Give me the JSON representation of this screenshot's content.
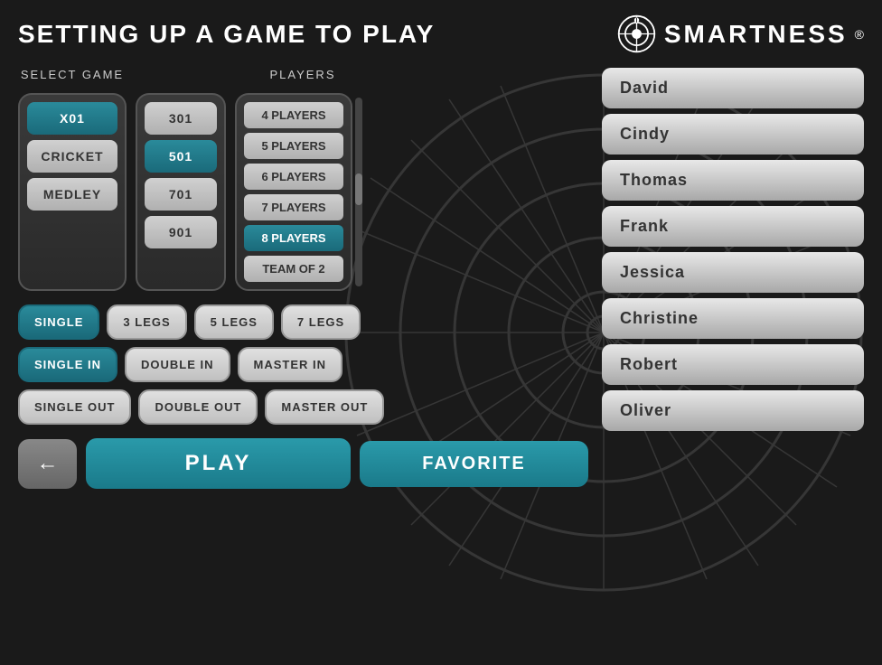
{
  "header": {
    "title": "SETTING UP A GAME TO PLAY",
    "logo_text": "SMARTNESS",
    "logo_reg": "®"
  },
  "game_section": {
    "label": "SELECT GAME",
    "game_types": [
      {
        "id": "x01",
        "label": "X01",
        "active": true
      },
      {
        "id": "cricket",
        "label": "CRICKET",
        "active": false
      },
      {
        "id": "medley",
        "label": "MEDLEY",
        "active": false
      }
    ],
    "scores": [
      {
        "id": "301",
        "label": "301",
        "active": false
      },
      {
        "id": "501",
        "label": "501",
        "active": true
      },
      {
        "id": "701",
        "label": "701",
        "active": false
      },
      {
        "id": "901",
        "label": "901",
        "active": false
      }
    ]
  },
  "players_section": {
    "label": "PLAYERS",
    "options": [
      {
        "id": "4players",
        "label": "4 PLAYERS",
        "active": false
      },
      {
        "id": "5players",
        "label": "5 PLAYERS",
        "active": false
      },
      {
        "id": "6players",
        "label": "6 PLAYERS",
        "active": false
      },
      {
        "id": "7players",
        "label": "7 PLAYERS",
        "active": false
      },
      {
        "id": "8players",
        "label": "8 PLAYERS",
        "active": true
      },
      {
        "id": "teamof2",
        "label": "TEAM OF 2",
        "active": false
      }
    ]
  },
  "game_options": {
    "legs": [
      {
        "id": "single",
        "label": "SINGLE",
        "active": true
      },
      {
        "id": "3legs",
        "label": "3 LEGS",
        "active": false
      },
      {
        "id": "5legs",
        "label": "5 LEGS",
        "active": false
      },
      {
        "id": "7legs",
        "label": "7 LEGS",
        "active": false
      }
    ],
    "in_options": [
      {
        "id": "singlein",
        "label": "SINGLE IN",
        "active": true
      },
      {
        "id": "doublein",
        "label": "DOUBLE IN",
        "active": false
      },
      {
        "id": "masterin",
        "label": "MASTER IN",
        "active": false
      }
    ],
    "out_options": [
      {
        "id": "singleout",
        "label": "SINGLE OUT",
        "active": false
      },
      {
        "id": "doubleout",
        "label": "DOUBLE OUT",
        "active": false
      },
      {
        "id": "masterout",
        "label": "MASTER OUT",
        "active": false
      }
    ]
  },
  "actions": {
    "back_label": "←",
    "play_label": "PLAY",
    "favorite_label": "FAVORITE"
  },
  "players_list": [
    {
      "id": "david",
      "label": "David"
    },
    {
      "id": "cindy",
      "label": "Cindy"
    },
    {
      "id": "thomas",
      "label": "Thomas"
    },
    {
      "id": "frank",
      "label": "Frank"
    },
    {
      "id": "jessica",
      "label": "Jessica"
    },
    {
      "id": "christine",
      "label": "Christine"
    },
    {
      "id": "robert",
      "label": "Robert"
    },
    {
      "id": "oliver",
      "label": "Oliver"
    }
  ]
}
